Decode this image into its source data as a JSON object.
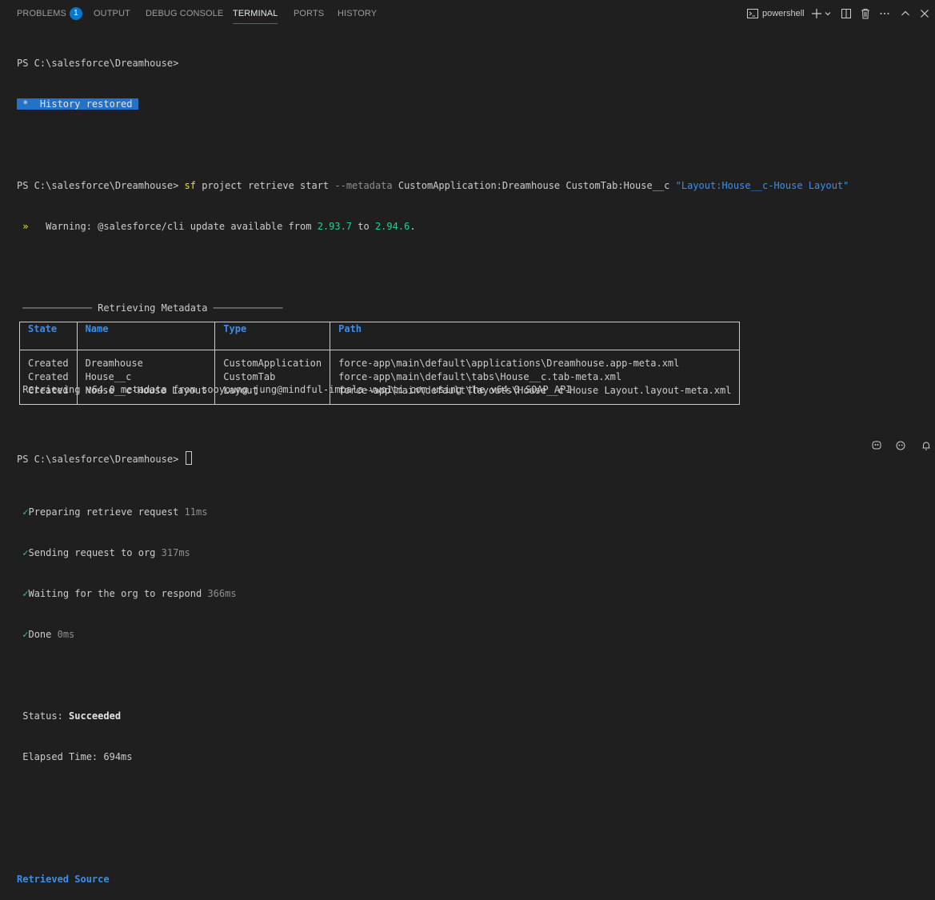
{
  "tabs": [
    {
      "label": "PROBLEMS",
      "badge": "1"
    },
    {
      "label": "OUTPUT"
    },
    {
      "label": "DEBUG CONSOLE"
    },
    {
      "label": "TERMINAL"
    },
    {
      "label": "PORTS"
    },
    {
      "label": "HISTORY"
    }
  ],
  "active_tab": "TERMINAL",
  "terminal_profile": "powershell",
  "icons": {
    "terminal": "terminal-icon",
    "add": "plus-icon",
    "dropdown": "chevron-down-icon",
    "split": "split-terminal-icon",
    "trash": "trash-icon",
    "more": "ellipsis-icon",
    "maximize": "chevron-up-icon",
    "close": "close-icon",
    "copilot": "copilot-icon",
    "bell": "bell-icon"
  },
  "lines": {
    "prompt1": "PS C:\\salesforce\\Dreamhouse>",
    "history_restored": " *  History restored ",
    "prompt2": "PS C:\\salesforce\\Dreamhouse>",
    "cmd_sf": "sf",
    "cmd_rest1": " project retrieve start ",
    "cmd_flag": "--metadata",
    "cmd_rest2": " CustomApplication:Dreamhouse CustomTab:House__c ",
    "cmd_quoted": "\"Layout:House__c-House Layout\"",
    "warn_arrow": " »",
    "warn_text1": "   Warning: @salesforce/cli update available from ",
    "warn_from": "2.93.7",
    "warn_to_word": " to ",
    "warn_to": "2.94.6",
    "warn_end": ".",
    "rule_left": " ──────────── ",
    "rule_title": "Retrieving Metadata",
    "rule_right": " ────────────",
    "retrieving": " Retrieving v64.0 metadata from sooyoung.jung@mindful-impala-vwo1ti.com using the v64.0 SOAP API",
    "steps": [
      {
        "check": "✓",
        "label": "Preparing retrieve request ",
        "time": "11ms"
      },
      {
        "check": "✓",
        "label": "Sending request to org ",
        "time": "317ms"
      },
      {
        "check": "✓",
        "label": "Waiting for the org to respond ",
        "time": "366ms"
      },
      {
        "check": "✓",
        "label": "Done ",
        "time": "0ms"
      }
    ],
    "status_label": " Status: ",
    "status_value": "Succeeded",
    "elapsed": " Elapsed Time: 694ms",
    "retrieved_source": "Retrieved Source",
    "prompt3": "PS C:\\salesforce\\Dreamhouse>"
  },
  "table": {
    "headers": [
      "State",
      "Name",
      "Type",
      "Path"
    ],
    "rows": [
      [
        "Created",
        "Dreamhouse",
        "CustomApplication",
        "force-app\\main\\default\\applications\\Dreamhouse.app-meta.xml"
      ],
      [
        "Created",
        "House__c",
        "CustomTab",
        "force-app\\main\\default\\tabs\\House__c.tab-meta.xml"
      ],
      [
        "Created",
        "House__c-House Layout",
        "Layout",
        "force-app\\main\\default\\layouts\\House__c-House Layout.layout-meta.xml"
      ]
    ]
  }
}
